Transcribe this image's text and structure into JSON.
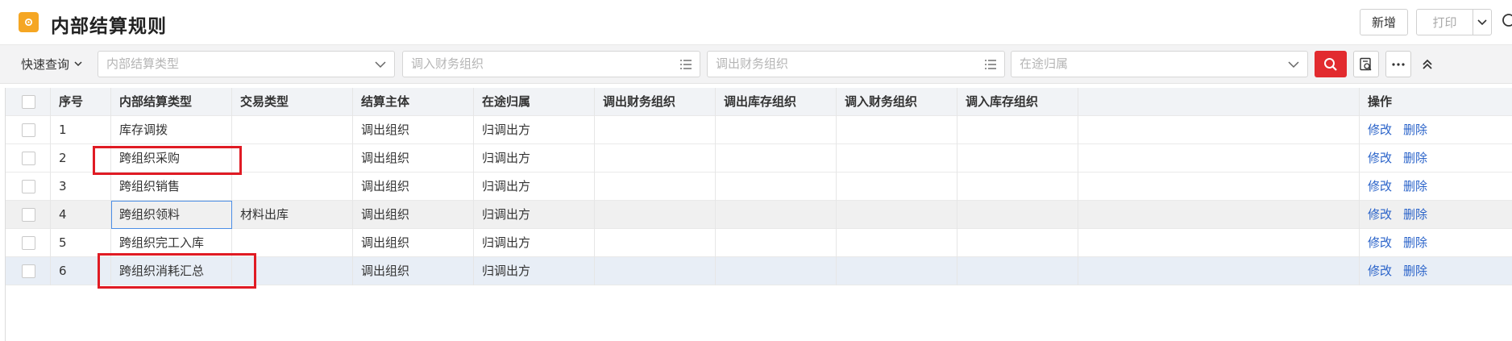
{
  "header": {
    "title": "内部结算规则",
    "new_label": "新增",
    "print_label": "打印"
  },
  "filter": {
    "quick_query": "快速查询",
    "settle_type_placeholder": "内部结算类型",
    "in_finance_placeholder": "调入财务组织",
    "out_finance_placeholder": "调出财务组织",
    "transit_owner_placeholder": "在途归属"
  },
  "table": {
    "columns": [
      "序号",
      "内部结算类型",
      "交易类型",
      "结算主体",
      "在途归属",
      "调出财务组织",
      "调出库存组织",
      "调入财务组织",
      "调入库存组织",
      "操作"
    ],
    "rows": [
      {
        "no": "1",
        "type": "库存调拨",
        "trade": "",
        "subject": "调出组织",
        "transit": "归调出方"
      },
      {
        "no": "2",
        "type": "跨组织采购",
        "trade": "",
        "subject": "调出组织",
        "transit": "归调出方"
      },
      {
        "no": "3",
        "type": "跨组织销售",
        "trade": "",
        "subject": "调出组织",
        "transit": "归调出方"
      },
      {
        "no": "4",
        "type": "跨组织领料",
        "trade": "材料出库",
        "subject": "调出组织",
        "transit": "归调出方"
      },
      {
        "no": "5",
        "type": "跨组织完工入库",
        "trade": "",
        "subject": "调出组织",
        "transit": "归调出方"
      },
      {
        "no": "6",
        "type": "跨组织消耗汇总",
        "trade": "",
        "subject": "调出组织",
        "transit": "归调出方"
      }
    ],
    "edit_label": "修改",
    "delete_label": "删除"
  },
  "colors": {
    "accent_red": "#e22b2f",
    "link_blue": "#2a63c9",
    "app_icon": "#f5a623",
    "annotation_red": "#e01b24"
  }
}
